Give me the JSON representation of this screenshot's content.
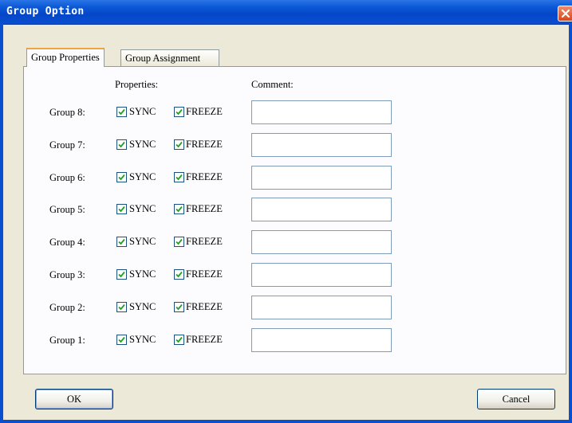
{
  "window": {
    "title": "Group Option"
  },
  "tabs": [
    {
      "label": "Group Properties",
      "active": true
    },
    {
      "label": "Group Assignment",
      "active": false
    }
  ],
  "headers": {
    "properties": "Properties:",
    "comment": "Comment:"
  },
  "groups": [
    {
      "label": "Group 8:",
      "sync_label": "SYNC",
      "sync_checked": true,
      "freeze_label": "FREEZE",
      "freeze_checked": true,
      "comment": ""
    },
    {
      "label": "Group 7:",
      "sync_label": "SYNC",
      "sync_checked": true,
      "freeze_label": "FREEZE",
      "freeze_checked": true,
      "comment": ""
    },
    {
      "label": "Group 6:",
      "sync_label": "SYNC",
      "sync_checked": true,
      "freeze_label": "FREEZE",
      "freeze_checked": true,
      "comment": ""
    },
    {
      "label": "Group 5:",
      "sync_label": "SYNC",
      "sync_checked": true,
      "freeze_label": "FREEZE",
      "freeze_checked": true,
      "comment": ""
    },
    {
      "label": "Group 4:",
      "sync_label": "SYNC",
      "sync_checked": true,
      "freeze_label": "FREEZE",
      "freeze_checked": true,
      "comment": ""
    },
    {
      "label": "Group 3:",
      "sync_label": "SYNC",
      "sync_checked": true,
      "freeze_label": "FREEZE",
      "freeze_checked": true,
      "comment": ""
    },
    {
      "label": "Group 2:",
      "sync_label": "SYNC",
      "sync_checked": true,
      "freeze_label": "FREEZE",
      "freeze_checked": true,
      "comment": ""
    },
    {
      "label": "Group 1:",
      "sync_label": "SYNC",
      "sync_checked": true,
      "freeze_label": "FREEZE",
      "freeze_checked": true,
      "comment": ""
    }
  ],
  "buttons": {
    "ok": "OK",
    "cancel": "Cancel"
  },
  "icons": {
    "close": "close-icon",
    "check": "checkmark-icon"
  },
  "colors": {
    "titlebar": "#0a58d6",
    "dialog_bg": "#ece9d8",
    "active_tab_accent": "#f3a33b",
    "check": "#21a121"
  }
}
